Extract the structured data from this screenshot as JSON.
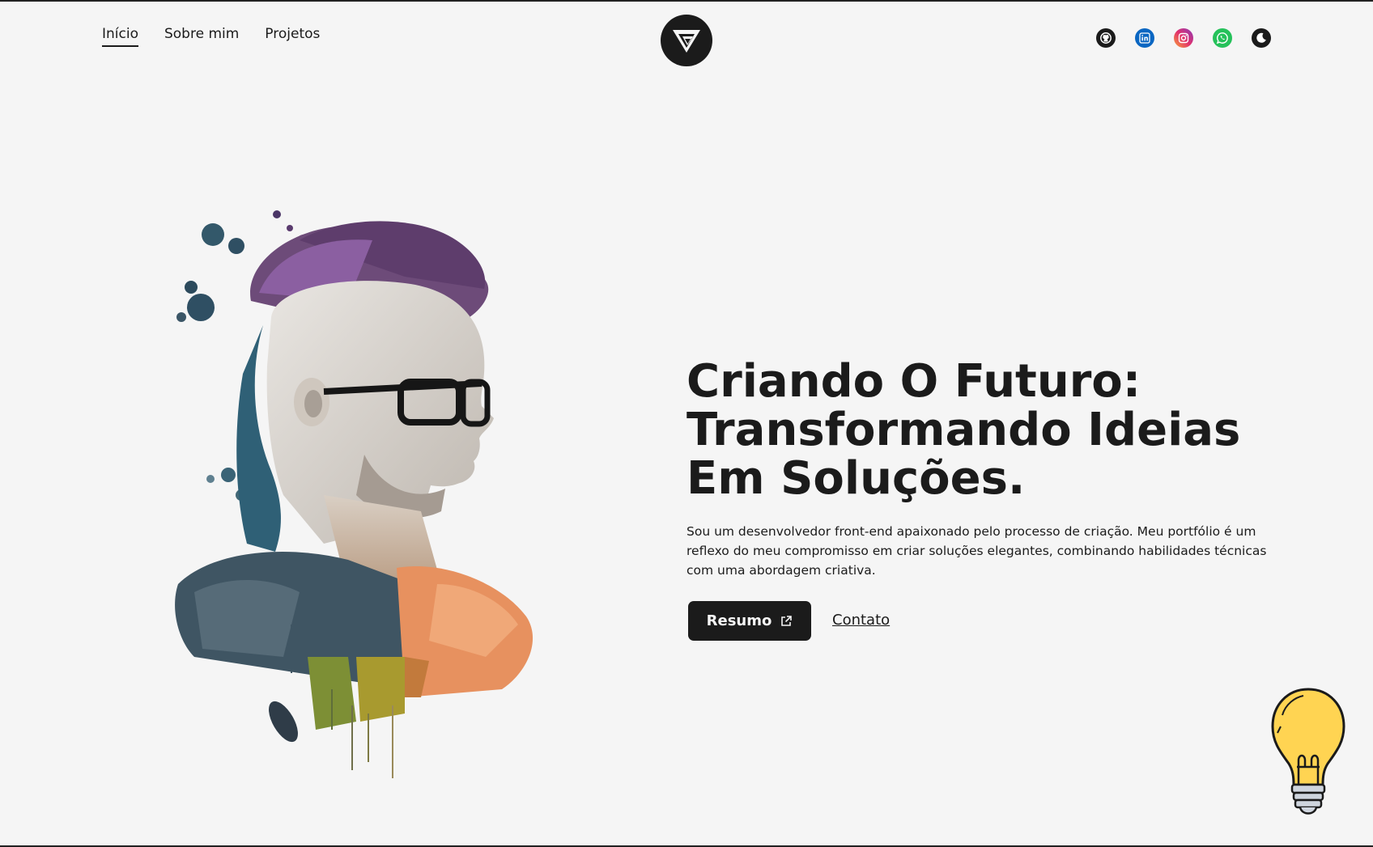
{
  "nav": {
    "items": [
      {
        "label": "Início",
        "active": true
      },
      {
        "label": "Sobre mim",
        "active": false
      },
      {
        "label": "Projetos",
        "active": false
      }
    ]
  },
  "logo": {
    "icon": "triangle-logo-icon"
  },
  "socials": [
    {
      "name": "github",
      "icon": "github-icon",
      "color": "#1b1b1b"
    },
    {
      "name": "linkedin",
      "icon": "linkedin-icon",
      "color": "#0a66c2"
    },
    {
      "name": "instagram",
      "icon": "instagram-icon",
      "color": "#e1306c"
    },
    {
      "name": "whatsapp",
      "icon": "whatsapp-icon",
      "color": "#25c15a"
    },
    {
      "name": "theme",
      "icon": "moon-icon",
      "color": "#1b1b1b"
    }
  ],
  "hero": {
    "headline_lines": [
      "Criando O Futuro:",
      "Transformando Ideias",
      "Em Soluções."
    ],
    "intro": "Sou um desenvolvedor front-end apaixonado pelo processo de criação. Meu portfólio é um reflexo do meu compromisso em criar soluções elegantes, combinando habilidades técnicas com uma abordagem criativa.",
    "resume_label": "Resumo",
    "contact_label": "Contato"
  },
  "colors": {
    "background": "#f5f5f5",
    "text": "#1b1b1b",
    "button_bg": "#1b1b1b",
    "button_text": "#f5f5f5"
  }
}
